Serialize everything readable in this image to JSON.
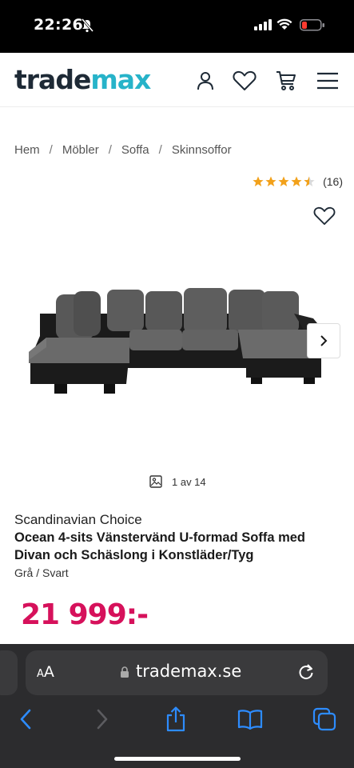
{
  "status": {
    "time": "22:26"
  },
  "header": {
    "logo_part1": "trade",
    "logo_part2": "max"
  },
  "breadcrumb": {
    "items": [
      "Hem",
      "Möbler",
      "Soffa",
      "Skinnsoffor"
    ],
    "separator": "/"
  },
  "rating": {
    "stars": 4.5,
    "max": 5,
    "count": "(16)"
  },
  "gallery": {
    "counter": "1 av 14"
  },
  "product": {
    "brand": "Scandinavian Choice",
    "title": "Ocean 4-sits Vänstervänd U-formad Soffa med Divan och Schäslong i Konstläder/Tyg",
    "variant": "Grå / Svart",
    "price": "21 999:-"
  },
  "browser": {
    "aa_label_small": "A",
    "aa_label_large": "A",
    "url": "trademax.se"
  },
  "colors": {
    "brand_dark": "#1e2a36",
    "brand_accent": "#27b3c9",
    "price": "#d6115b",
    "star": "#f2a11a"
  },
  "icons": {
    "account": "person-icon",
    "wishlist": "heart-icon",
    "cart": "cart-icon",
    "menu": "hamburger-icon"
  }
}
